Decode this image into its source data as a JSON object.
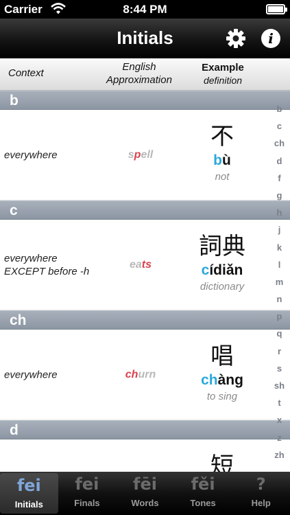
{
  "status": {
    "carrier": "Carrier",
    "time": "8:44 PM",
    "battery_level": 0.9
  },
  "nav": {
    "title": "Initials",
    "settings_icon": "gear-icon",
    "info_icon": "info-icon",
    "info_glyph": "i"
  },
  "columns": {
    "context": "Context",
    "english_line1": "English",
    "english_line2": "Approximation",
    "example_line1": "Example",
    "example_line2": "definition"
  },
  "sections": [
    {
      "letter": "b",
      "context_line1": "everywhere",
      "context_line2": "",
      "approx_pre": "s",
      "approx_hl": "p",
      "approx_post": "ell",
      "hanzi": "不",
      "pinyin_initial": "b",
      "pinyin_rest": "ù",
      "gloss": "not"
    },
    {
      "letter": "c",
      "context_line1": "everywhere",
      "context_line2": "EXCEPT before -h",
      "approx_pre": "ea",
      "approx_hl": "ts",
      "approx_post": "",
      "hanzi": "詞典",
      "pinyin_initial": "c",
      "pinyin_rest": "ídiǎn",
      "gloss": "dictionary"
    },
    {
      "letter": "ch",
      "context_line1": "everywhere",
      "context_line2": "",
      "approx_pre": "",
      "approx_hl": "ch",
      "approx_post": "urn",
      "hanzi": "唱",
      "pinyin_initial": "ch",
      "pinyin_rest": "àng",
      "gloss": "to sing"
    },
    {
      "letter": "d",
      "context_line1": "",
      "context_line2": "",
      "approx_pre": "",
      "approx_hl": "",
      "approx_post": "",
      "hanzi": "短",
      "pinyin_initial": "",
      "pinyin_rest": "",
      "gloss": ""
    }
  ],
  "index": [
    "b",
    "c",
    "ch",
    "d",
    "f",
    "g",
    "h",
    "j",
    "k",
    "l",
    "m",
    "n",
    "p",
    "q",
    "r",
    "s",
    "sh",
    "t",
    "x",
    "z",
    "zh"
  ],
  "tabs": [
    {
      "icon": "fei",
      "label": "Initials",
      "active": true
    },
    {
      "icon": "fei",
      "label": "Finals",
      "active": false
    },
    {
      "icon": "fēi",
      "label": "Words",
      "active": false
    },
    {
      "icon": "fěi",
      "label": "Tones",
      "active": false
    },
    {
      "icon": "?",
      "label": "Help",
      "active": false
    }
  ],
  "colors": {
    "initial_blue": "#2aa8dc",
    "highlight_red": "#d8404e",
    "section_gray": "#98a2ae"
  }
}
